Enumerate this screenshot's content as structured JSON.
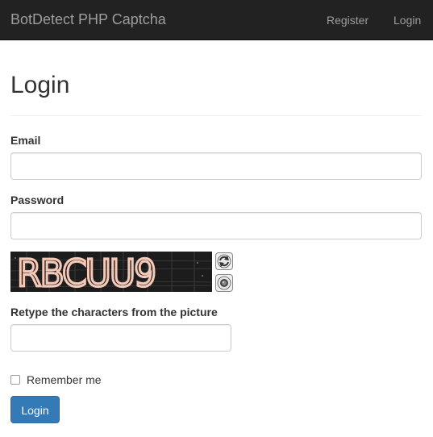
{
  "navbar": {
    "brand": "BotDetect PHP Captcha",
    "links": [
      "Register",
      "Login"
    ]
  },
  "form": {
    "title": "Login",
    "email_label": "Email",
    "email_value": "",
    "password_label": "Password",
    "password_value": "",
    "captcha_text": "RBCUU9",
    "captcha_label": "Retype the characters from the picture",
    "captcha_value": "",
    "remember_label": "Remember me",
    "remember_checked": false,
    "submit_label": "Login"
  },
  "colors": {
    "navbar_bg": "#222222",
    "navbar_text": "#9d9d9d",
    "primary": "#337ab7",
    "captcha_glyph": "#f4c9b8"
  },
  "icons": {
    "reload": "reload-icon",
    "sound": "speaker-icon"
  }
}
